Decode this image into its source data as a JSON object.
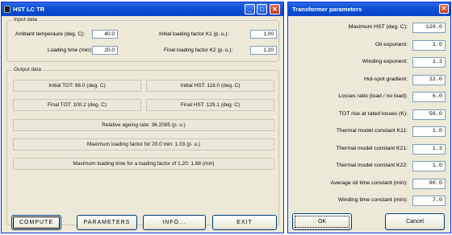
{
  "main_window": {
    "title": "HST LC TR",
    "controls": {
      "minimize": "_",
      "maximize": "□",
      "close": "✕"
    },
    "input_group": {
      "title": "Input data",
      "ambient_label": "Ambiant temperaure (deg. C):",
      "ambient_value": "40.0",
      "loading_time_label": "Loading time (min):",
      "loading_time_value": "20.0",
      "k1_label": "Initial loading factor K1 (p. u.):",
      "k1_value": "1.00",
      "k2_label": "Final loading factor K2 (p. u.):",
      "k2_value": "1.20"
    },
    "output_group": {
      "title": "Output data",
      "initial_tot": "Initial TOT:  96.0 (deg. C)",
      "initial_hst": "Initial HST:  118.0 (deg. C)",
      "final_tot": "Final TOT:  100.2 (deg. C)",
      "final_hst": "Final HST:  129.1 (deg. C)",
      "ageing_rate": "Relative ageing rate:  36.2095 (p. u.)",
      "max_loading_factor": "Maximum loading factor for 20.0 min:  1.03 (p. u.)",
      "max_loading_time": "Maximum loading time for a loading factor of 1.20:  1.68 (min)"
    },
    "buttons": {
      "compute": "COMPUTE",
      "parameters": "PARAMETERS",
      "info": "INFO...",
      "exit": "EXIT"
    }
  },
  "param_window": {
    "title": "Transformer parameters",
    "close": "✕",
    "params": [
      {
        "label": "Maximum HST (deg. C):",
        "value": "120.0"
      },
      {
        "label": "Oil exponent:",
        "value": "1.0"
      },
      {
        "label": "Winding exponent:",
        "value": "1.3"
      },
      {
        "label": "Hot-spot gradient:",
        "value": "22.0"
      },
      {
        "label": "Losses ratio (load / no load):",
        "value": "6.0"
      },
      {
        "label": "TOT rise at rated losses (K):",
        "value": "56.0"
      },
      {
        "label": "Thermal model constant K11:",
        "value": "1.0"
      },
      {
        "label": "Thermal model constant K21:",
        "value": "1.3"
      },
      {
        "label": "Thermal model constant K22:",
        "value": "1.0"
      },
      {
        "label": "Average oil time constant (min):",
        "value": "90.0"
      },
      {
        "label": "Winding time constant (min):",
        "value": "7.0"
      }
    ],
    "ok_label": "OK",
    "cancel_label": "Cancel"
  },
  "colors": {
    "title_bar": "#0a4fd6",
    "window_bg": "#ece9d8",
    "close_button": "#c53a1d"
  }
}
